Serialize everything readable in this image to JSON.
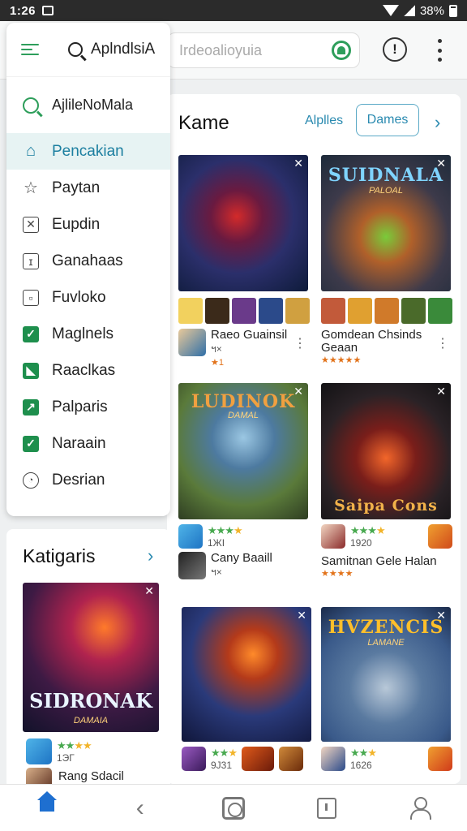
{
  "status_bar": {
    "time": "1:26",
    "battery": "38%"
  },
  "search": {
    "placeholder": "Irdeoalioyuia"
  },
  "drawer": {
    "title": "AplndlsiA",
    "search_label": "AjlileNoMala",
    "items": [
      {
        "label": "Pencakian",
        "icon": "home-icon"
      },
      {
        "label": "Paytan",
        "icon": "puzzle-icon"
      },
      {
        "label": "Eupdin",
        "icon": "box-x-icon"
      },
      {
        "label": "Ganahaas",
        "icon": "page-icon"
      },
      {
        "label": "Fuvloko",
        "icon": "square-dot-icon"
      },
      {
        "label": "Maglnels",
        "icon": "check-green-icon"
      },
      {
        "label": "Raaclkas",
        "icon": "corner-green-icon"
      },
      {
        "label": "Palparis",
        "icon": "arrow-green-icon"
      },
      {
        "label": "Naraain",
        "icon": "check-green-icon"
      },
      {
        "label": "Desrian",
        "icon": "chat-icon"
      }
    ]
  },
  "main": {
    "title": "Kame",
    "link_label": "Alplles",
    "pill_label": "Dames",
    "games": [
      {
        "name": "Raeo Guainsil",
        "sub": "ฯ×",
        "rating_text": "★1",
        "art_title": "",
        "art_sub": ""
      },
      {
        "name": "Gomdean Chsinds Geaan",
        "sub": "",
        "rating_text": "★★★★★",
        "art_title": "SUIDNALA",
        "art_sub": "PALOAL"
      },
      {
        "name": "Cany Baaill",
        "sub": "ฯ×",
        "rating_text": "★★★★",
        "count": "1ЖI",
        "art_title": "LUDINOK",
        "art_sub": "DAMAL"
      },
      {
        "name": "Samitnan Gele Halan",
        "sub": "",
        "rating_text": "★★★★",
        "count": "1920",
        "art_title": "Saipa Cons",
        "art_sub": ""
      },
      {
        "name": "",
        "sub": "",
        "rating_text": "★★★",
        "count": "9J31",
        "art_title": "",
        "art_sub": ""
      },
      {
        "name": "",
        "sub": "",
        "rating_text": "★★★",
        "count": "1626",
        "art_title": "HVZENCIS",
        "art_sub": "LAMANE"
      }
    ]
  },
  "category": {
    "title": "Katigaris",
    "art_title": "SIDRONAK",
    "art_sub": "DAMAIA",
    "count": "1ЭГ",
    "name": "Rang Sdacil"
  },
  "colors": {
    "accent_green": "#2e9e5b",
    "accent_blue": "#2a8ab0",
    "nav_blue": "#1e6fd0"
  }
}
